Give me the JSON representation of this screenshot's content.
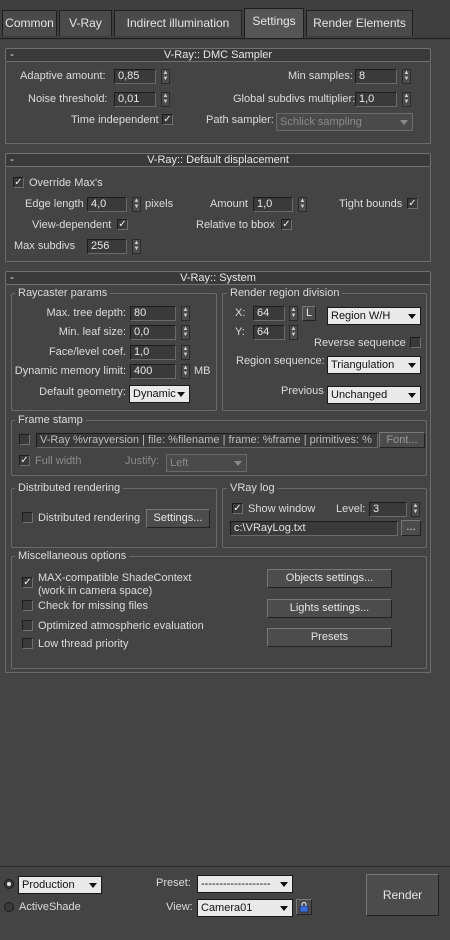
{
  "tabs": [
    "Common",
    "V-Ray",
    "Indirect illumination",
    "Settings",
    "Render Elements"
  ],
  "active_tab": "Settings",
  "dmc": {
    "minus": "-",
    "title": "V-Ray:: DMC Sampler",
    "adaptive_amount_label": "Adaptive amount:",
    "adaptive_amount": "0,85",
    "noise_threshold_label": "Noise threshold:",
    "noise_threshold": "0,01",
    "time_independent_label": "Time independent",
    "min_samples_label": "Min samples:",
    "min_samples": "8",
    "global_subdivs_label": "Global subdivs multiplier:",
    "global_subdivs": "1,0",
    "path_sampler_label": "Path sampler:",
    "path_sampler": "Schlick sampling"
  },
  "disp": {
    "minus": "-",
    "title": "V-Ray:: Default displacement",
    "override_label": "Override Max's",
    "edge_length_label": "Edge length",
    "edge_length": "4,0",
    "pixels_label": "pixels",
    "amount_label": "Amount",
    "amount": "1,0",
    "tight_bounds_label": "Tight bounds",
    "view_dependent_label": "View-dependent",
    "relative_bbox_label": "Relative to bbox",
    "max_subdivs_label": "Max subdivs",
    "max_subdivs": "256"
  },
  "system": {
    "minus": "-",
    "title": "V-Ray:: System",
    "raycaster": {
      "title": "Raycaster params",
      "max_tree_depth_label": "Max. tree depth:",
      "max_tree_depth": "80",
      "min_leaf_label": "Min. leaf size:",
      "min_leaf": "0,0",
      "face_level_label": "Face/level coef.",
      "face_level": "1,0",
      "dyn_mem_label": "Dynamic memory limit:",
      "dyn_mem": "400",
      "mb_label": "MB",
      "default_geometry_label": "Default geometry:",
      "default_geometry": "Dynamic"
    },
    "region": {
      "title": "Render region division",
      "x_label": "X:",
      "x": "64",
      "y_label": "Y:",
      "y": "64",
      "l_button": "L",
      "mode": "Region W/H",
      "reverse_label": "Reverse sequence",
      "region_sequence_label": "Region sequence:",
      "region_sequence": "Triangulation",
      "previous_label": "Previous",
      "previous": "Unchanged"
    },
    "frame_stamp": {
      "title": "Frame stamp",
      "text": "V-Ray %vrayversion | file: %filename | frame: %frame | primitives: %",
      "font_button": "Font...",
      "full_width_label": "Full width",
      "justify_label": "Justify:",
      "justify": "Left"
    },
    "distributed": {
      "title": "Distributed rendering",
      "label": "Distributed rendering",
      "settings_button": "Settings..."
    },
    "vraylog": {
      "title": "VRay log",
      "show_window_label": "Show window",
      "level_label": "Level:",
      "level": "3",
      "path": "c:\\VRayLog.txt",
      "browse_button": "..."
    },
    "misc": {
      "title": "Miscellaneous options",
      "max_compat_line1": "MAX-compatible ShadeContext",
      "max_compat_line2": "(work in camera space)",
      "missing_files_label": "Check for missing files",
      "optimized_atm_label": "Optimized atmospheric evaluation",
      "low_thread_label": "Low thread priority",
      "objects_button": "Objects settings...",
      "lights_button": "Lights settings...",
      "presets_button": "Presets"
    }
  },
  "bottom": {
    "production_label": "Production",
    "activeshade_label": "ActiveShade",
    "preset_label": "Preset:",
    "preset_value": "-------------------",
    "view_label": "View:",
    "view_value": "Camera01",
    "render_button": "Render"
  }
}
